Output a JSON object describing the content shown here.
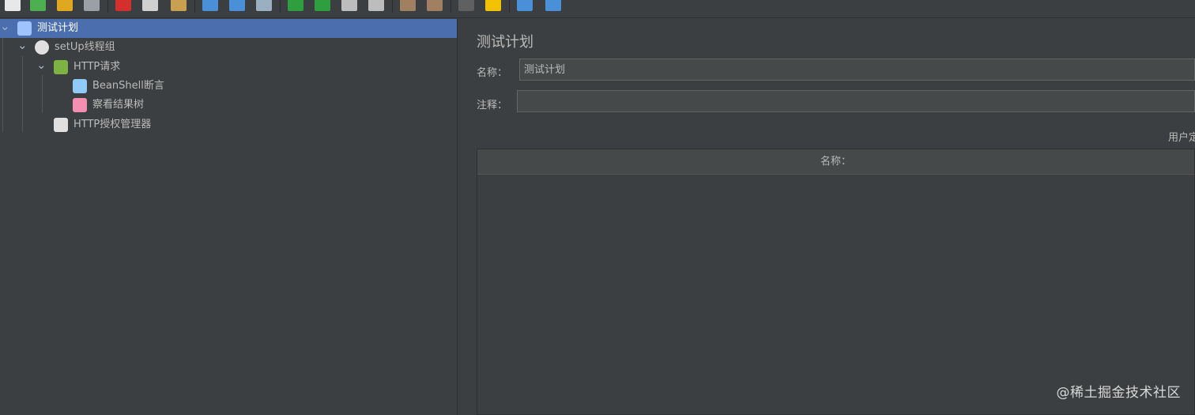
{
  "toolbar": {
    "buttons": [
      {
        "name": "new-icon",
        "color": "#e8e8e8"
      },
      {
        "name": "templates-icon",
        "color": "#4caf50"
      },
      {
        "name": "open-icon",
        "color": "#e0a820"
      },
      {
        "name": "save-icon",
        "color": "#9aa0a6"
      },
      {
        "name": "cut-icon",
        "color": "#d32f2f"
      },
      {
        "name": "copy-icon",
        "color": "#d0d0d0"
      },
      {
        "name": "paste-icon",
        "color": "#c8a050"
      },
      {
        "name": "expand-icon",
        "color": "#4a90d9"
      },
      {
        "name": "collapse-icon",
        "color": "#4a90d9"
      },
      {
        "name": "toggle-icon",
        "color": "#9ab0c0"
      },
      {
        "name": "start-icon",
        "color": "#2e9e3e"
      },
      {
        "name": "start-no-pause-icon",
        "color": "#2e9e3e"
      },
      {
        "name": "stop-icon",
        "color": "#bdbdbd"
      },
      {
        "name": "shutdown-icon",
        "color": "#bdbdbd"
      },
      {
        "name": "clear-icon",
        "color": "#a08060"
      },
      {
        "name": "clear-all-icon",
        "color": "#a08060"
      },
      {
        "name": "search-icon",
        "color": "#606060"
      },
      {
        "name": "reset-search-icon",
        "color": "#f2c200"
      },
      {
        "name": "function-helper-icon",
        "color": "#4a90d9"
      },
      {
        "name": "help-icon",
        "color": "#4a90d9"
      }
    ]
  },
  "tree": {
    "nodes": [
      {
        "label": "测试计划",
        "icon": "test-plan-icon",
        "level": 0,
        "expanded": true,
        "selected": true,
        "icon_color": "#9ec3ff"
      },
      {
        "label": "setUp线程组",
        "icon": "gear-icon",
        "level": 1,
        "expanded": true,
        "selected": false,
        "icon_color": "#e0e0e0"
      },
      {
        "label": "HTTP请求",
        "icon": "pen-icon",
        "level": 2,
        "expanded": true,
        "selected": false,
        "icon_color": "#7cb342"
      },
      {
        "label": "BeanShell断言",
        "icon": "magnifier-icon",
        "level": 3,
        "expanded": null,
        "selected": false,
        "icon_color": "#90caf9"
      },
      {
        "label": "察看结果树",
        "icon": "chart-icon",
        "level": 3,
        "expanded": null,
        "selected": false,
        "icon_color": "#f48fb1"
      },
      {
        "label": "HTTP授权管理器",
        "icon": "tools-icon",
        "level": 2,
        "expanded": null,
        "selected": false,
        "icon_color": "#e0e0e0"
      }
    ]
  },
  "editor": {
    "title": "测试计划",
    "name_label": "名称：",
    "name_value": "测试计划",
    "comment_label": "注释：",
    "comment_value": "",
    "section_label": "用户定",
    "table_header": "名称："
  },
  "watermark": "@稀土掘金技术社区"
}
